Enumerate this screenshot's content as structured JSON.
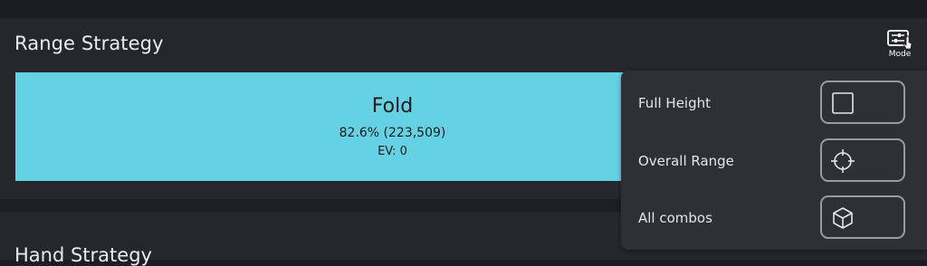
{
  "range_strategy": {
    "title": "Range Strategy",
    "mode_button": {
      "label": "Mode",
      "icon": "sliders-icon"
    },
    "fold": {
      "label": "Fold",
      "percent_text": "82.6% (223,509)",
      "ev_text": "EV: 0",
      "color": "#64d2e2"
    }
  },
  "mode_menu": {
    "options": [
      {
        "label": "Full Height",
        "icon": "square-icon"
      },
      {
        "label": "Overall Range",
        "icon": "crosshair-icon"
      },
      {
        "label": "All combos",
        "icon": "cube-icon"
      }
    ]
  },
  "hand_strategy": {
    "title": "Hand Strategy"
  }
}
